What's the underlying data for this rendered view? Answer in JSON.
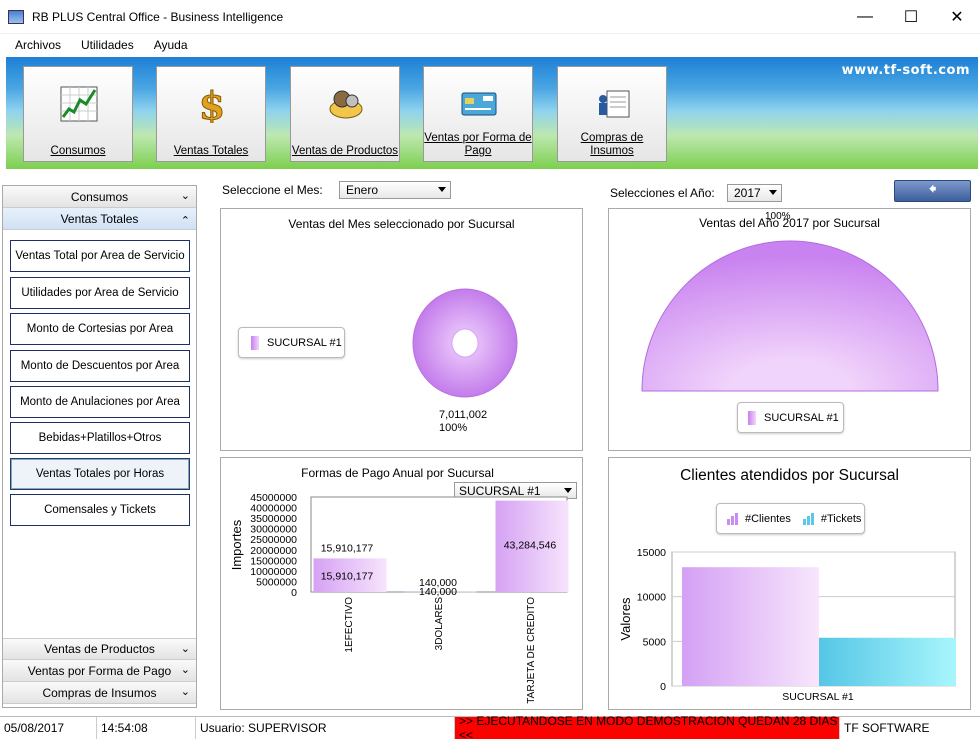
{
  "window": {
    "title": "RB PLUS  Central Office - Business Intelligence",
    "min": "—",
    "max": "☐",
    "close": "✕"
  },
  "menu": [
    "Archivos",
    "Utilidades",
    "Ayuda"
  ],
  "banner": {
    "url": "www.tf-soft.com",
    "buttons": [
      {
        "label": "Consumos",
        "icon": "chart-icon"
      },
      {
        "label": "Ventas Totales",
        "icon": "dollar-icon"
      },
      {
        "label": "Ventas de Productos",
        "icon": "products-icon"
      },
      {
        "label": "Ventas por Forma de Pago",
        "icon": "credit-card-icon"
      },
      {
        "label": "Compras de Insumos",
        "icon": "purchase-icon"
      }
    ]
  },
  "sidebar": {
    "headers": {
      "consumos": "Consumos",
      "ventas_totales": "Ventas Totales",
      "ventas_productos": "Ventas de Productos",
      "forma_pago": "Ventas por Forma de Pago",
      "compras": "Compras de Insumos"
    },
    "items": [
      "Ventas Total por Area de Servicio",
      "Utilidades por Area de Servicio",
      "Monto de Cortesias por Area",
      "Monto de Descuentos por Area",
      "Monto de Anulaciones por Area",
      "Bebidas+Platillos+Otros",
      "Ventas Totales por Horas",
      "Comensales y Tickets"
    ],
    "selected": "Ventas Totales por Horas"
  },
  "filters": {
    "mes_label": "Seleccione el Mes:",
    "mes_value": "Enero",
    "anio_label": "Selecciones el Año:",
    "anio_value": "2017"
  },
  "panels": {
    "mes": {
      "title": "Ventas del Mes seleccionado por Sucursal",
      "legend": "SUCURSAL #1",
      "value_label": "7,011,002",
      "pct_label": "100%"
    },
    "anio": {
      "title": "Ventas del Año 2017 por Sucursal",
      "legend": "SUCURSAL #1",
      "pct_label": "100%"
    },
    "pago": {
      "title": "Formas de Pago Anual por Sucursal",
      "select": "SUCURSAL #1",
      "ylabel": "Importes"
    },
    "clientes": {
      "title": "Clientes atendidos por Sucursal",
      "legend1": "#Clientes",
      "legend2": "#Tickets",
      "ylabel": "Valores",
      "xlabel": "SUCURSAL #1"
    }
  },
  "chart_data": [
    {
      "type": "pie",
      "title": "Ventas del Mes seleccionado por Sucursal",
      "categories": [
        "SUCURSAL #1"
      ],
      "values": [
        7011002
      ],
      "labels": [
        "7,011,002",
        "100%"
      ]
    },
    {
      "type": "pie",
      "title": "Ventas del Año 2017 por Sucursal",
      "categories": [
        "SUCURSAL #1"
      ],
      "values": [
        100
      ],
      "labels": [
        "100%"
      ]
    },
    {
      "type": "bar",
      "title": "Formas de Pago Anual por Sucursal",
      "categories": [
        "1EFECTIVO",
        "3DOLARES",
        "TARJETA DE CREDITO"
      ],
      "values": [
        15910177,
        140000,
        43284546
      ],
      "value_labels": [
        "15,910,177",
        "140,000",
        "43,284,546"
      ],
      "ylabel": "Importes",
      "ylim": [
        0,
        45000000
      ],
      "yticks": [
        "45000000",
        "40000000",
        "35000000",
        "30000000",
        "25000000",
        "20000000",
        "15000000",
        "10000000",
        "5000000",
        "0"
      ]
    },
    {
      "type": "bar",
      "title": "Clientes atendidos por Sucursal",
      "categories": [
        "SUCURSAL #1"
      ],
      "series": [
        {
          "name": "#Clientes",
          "values": [
            13300
          ]
        },
        {
          "name": "#Tickets",
          "values": [
            5400
          ]
        }
      ],
      "ylabel": "Valores",
      "ylim": [
        0,
        15000
      ],
      "yticks": [
        "15000",
        "10000",
        "5000",
        "0"
      ]
    }
  ],
  "status": {
    "date": "05/08/2017",
    "time": "14:54:08",
    "user": "Usuario:  SUPERVISOR",
    "warning": ">> EJECUTANDOSE EN MODO DEMOSTRACION QUEDAN 28 DIAS <<",
    "company": "TF SOFTWARE"
  },
  "colors": {
    "pie": "#c988f0",
    "bar_purple": "#d8a6f4",
    "bar_cyan": "#7fe3f0"
  }
}
